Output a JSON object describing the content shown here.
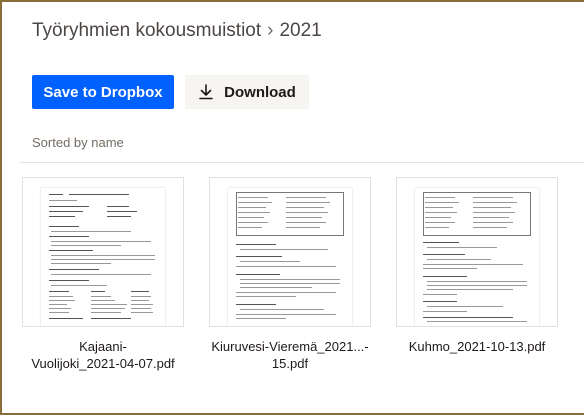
{
  "breadcrumb": {
    "parent": "Työryhmien kokousmuistiot",
    "separator": "›",
    "current": "2021"
  },
  "actions": {
    "save_label": "Save to Dropbox",
    "download_label": "Download",
    "download_icon": "download-icon"
  },
  "sort": {
    "label": "Sorted by name"
  },
  "files": [
    {
      "name": "Kajaani-\nVuolijoki_2021-04-07.pdf"
    },
    {
      "name": "Kiuruvesi-Vieremä_2021...-\n15.pdf"
    },
    {
      "name": "Kuhmo_2021-10-13.pdf"
    }
  ],
  "colors": {
    "primary": "#0061fe",
    "secondary_bg": "#f7f5f2",
    "frame": "#8a6d3b"
  }
}
